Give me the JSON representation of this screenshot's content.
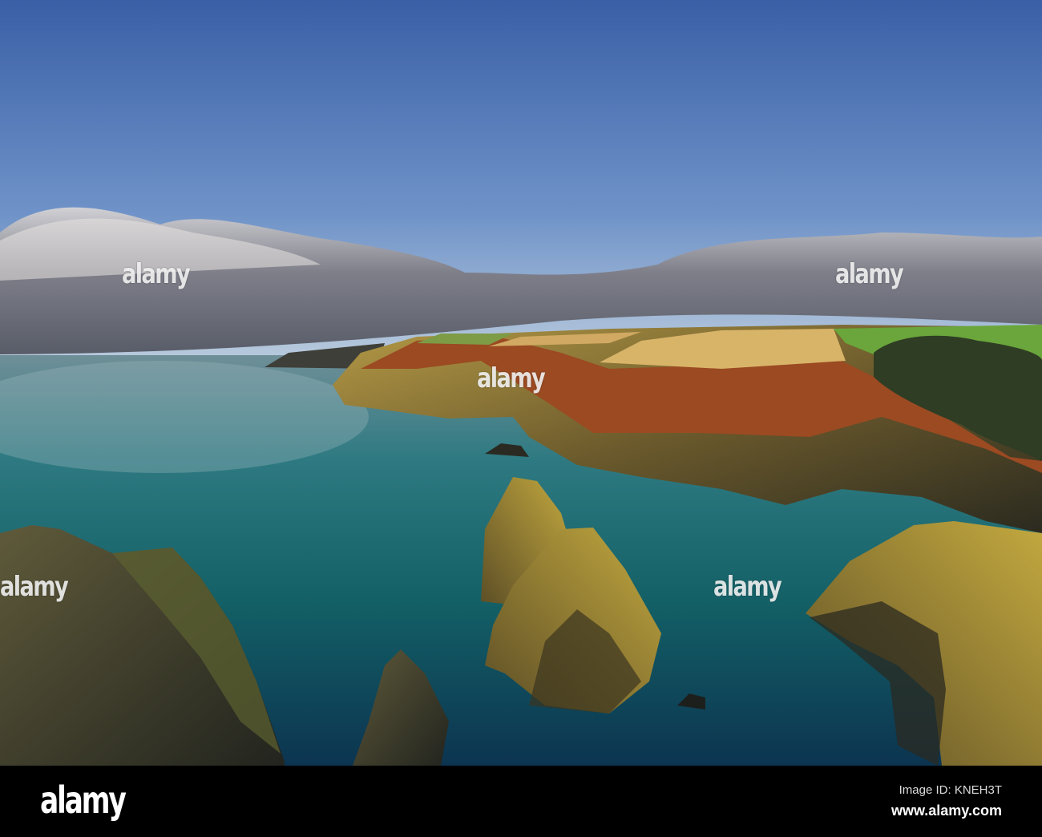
{
  "watermark": {
    "text": "alamy"
  },
  "footer": {
    "logo": "alamy",
    "image_id": "Image ID: KNEH3T",
    "website": "www.alamy.com"
  },
  "colors": {
    "sky_top": "#3d64a8",
    "sky_horizon": "#a9c2dd",
    "sea": "#1f5f6a",
    "field_gold": "#d8b368",
    "bracken": "#9a4a22",
    "grass": "#6aa83a",
    "rock": "#8a7a3a"
  }
}
